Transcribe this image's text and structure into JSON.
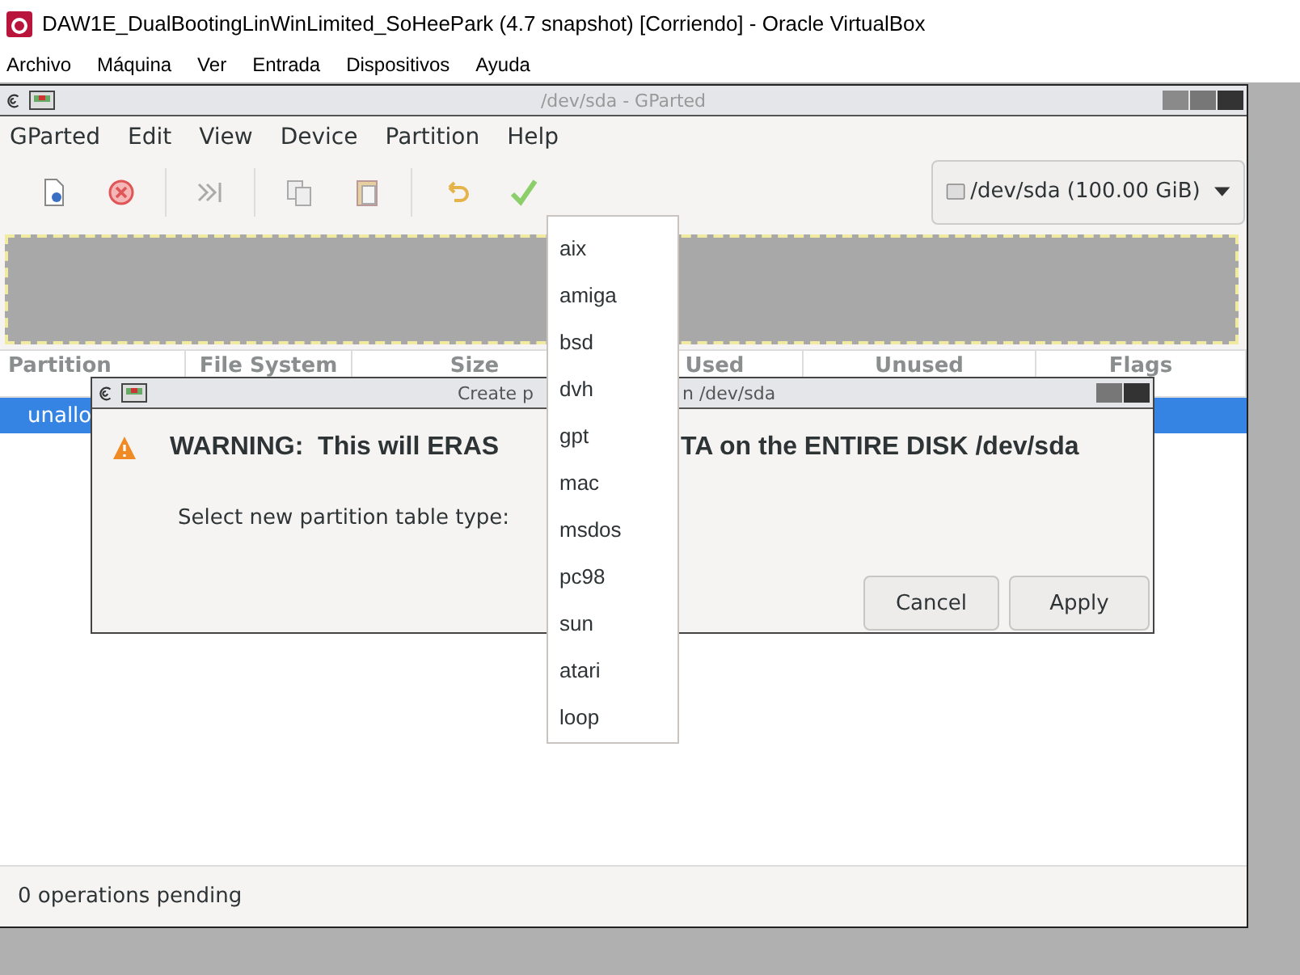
{
  "host_window": {
    "title": "DAW1E_DualBootingLinWinLimited_SoHeePark (4.7 snapshot) [Corriendo] - Oracle VirtualBox",
    "menu": [
      "Archivo",
      "Máquina",
      "Ver",
      "Entrada",
      "Dispositivos",
      "Ayuda"
    ]
  },
  "gparted": {
    "title": "/dev/sda - GParted",
    "menu": [
      "GParted",
      "Edit",
      "View",
      "Device",
      "Partition",
      "Help"
    ],
    "device": "/dev/sda (100.00 GiB)",
    "table": {
      "columns": [
        "Partition",
        "File System",
        "Size",
        "Used",
        "Unused",
        "Flags"
      ],
      "rows": [
        {
          "partition": "unallo",
          "selected": true
        }
      ]
    },
    "status_bar": "0 operations pending"
  },
  "dialog": {
    "title_parts": [
      "Create p",
      "n /dev/sda"
    ],
    "warning_parts": [
      "WARNING:  This will ERAS",
      "TA on the ENTIRE DISK /dev/sda"
    ],
    "prompt": "Select new partition table type:",
    "buttons": [
      "Cancel",
      "Apply"
    ]
  },
  "dropdown": {
    "items": [
      "aix",
      "amiga",
      "bsd",
      "dvh",
      "gpt",
      "mac",
      "msdos",
      "pc98",
      "sun",
      "atari",
      "loop"
    ]
  }
}
